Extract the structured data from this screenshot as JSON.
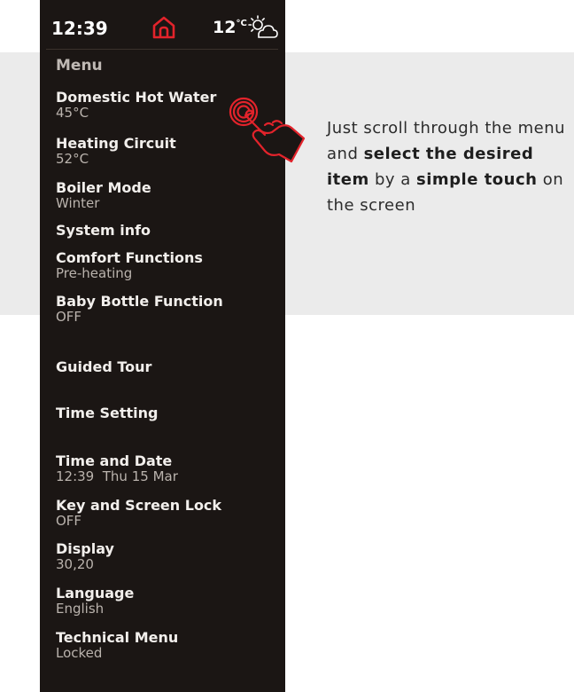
{
  "status": {
    "time": "12:39",
    "temperature": "12",
    "temperature_unit": "°C",
    "icons": {
      "home": "home-icon",
      "weather": "partly-cloudy-sun-icon"
    }
  },
  "menu": {
    "title": "Menu",
    "items": [
      {
        "label": "Domestic Hot Water",
        "value": "45°C"
      },
      {
        "label": "Heating Circuit",
        "value": "52°C"
      },
      {
        "label": "Boiler Mode",
        "value": "Winter"
      },
      {
        "label": "System info",
        "value": ""
      },
      {
        "label": "Comfort Functions",
        "value": "Pre-heating"
      },
      {
        "label": "Baby Bottle Function",
        "value": "OFF"
      },
      {
        "label": "Guided Tour",
        "value": ""
      },
      {
        "label": "Time Setting",
        "value": ""
      },
      {
        "label": "Time and Date",
        "value": "12:39  Thu 15 Mar"
      },
      {
        "label": "Key and Screen Lock",
        "value": "OFF"
      },
      {
        "label": "Display",
        "value": "30,20"
      },
      {
        "label": "Language",
        "value": "English"
      },
      {
        "label": "Technical Menu",
        "value": "Locked"
      }
    ]
  },
  "callout": {
    "part1": "Just scroll through the menu and ",
    "bold1": "select the desired item",
    "part2": " by a ",
    "bold2": "simple touch",
    "part3": " on the screen"
  },
  "colors": {
    "device_background": "#1b1614",
    "accent_red": "#e3232b",
    "page_band": "#ebebeb"
  }
}
